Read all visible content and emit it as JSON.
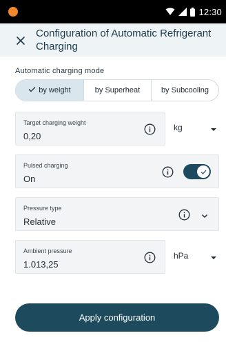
{
  "status_bar": {
    "time": "12:30",
    "icons": [
      "app-notification-icon",
      "wifi-icon",
      "signal-icon",
      "battery-icon"
    ]
  },
  "header": {
    "title": "Configuration of Automatic Refrigerant Charging",
    "close_icon": "close-icon"
  },
  "charging_mode": {
    "label": "Automatic charging mode",
    "options": [
      {
        "label": "by weight",
        "selected": true
      },
      {
        "label": "by Superheat",
        "selected": false
      },
      {
        "label": "by Subcooling",
        "selected": false
      }
    ]
  },
  "target_weight": {
    "label": "Target charging weight",
    "value": "0,20",
    "unit": "kg"
  },
  "pulsed_charging": {
    "label": "Pulsed charging",
    "value": "On",
    "enabled": true
  },
  "pressure_type": {
    "label": "Pressure type",
    "value": "Relative"
  },
  "ambient_pressure": {
    "label": "Ambient pressure",
    "value": "1.013,25",
    "unit": "hPa"
  },
  "apply_button": {
    "label": "Apply configuration"
  },
  "colors": {
    "primary": "#1d4b5d",
    "header_bg": "#eef3f6",
    "selected_segment": "#d9e6ee",
    "field_bg": "#f3f4f5",
    "status_dot": "#f0872e"
  }
}
